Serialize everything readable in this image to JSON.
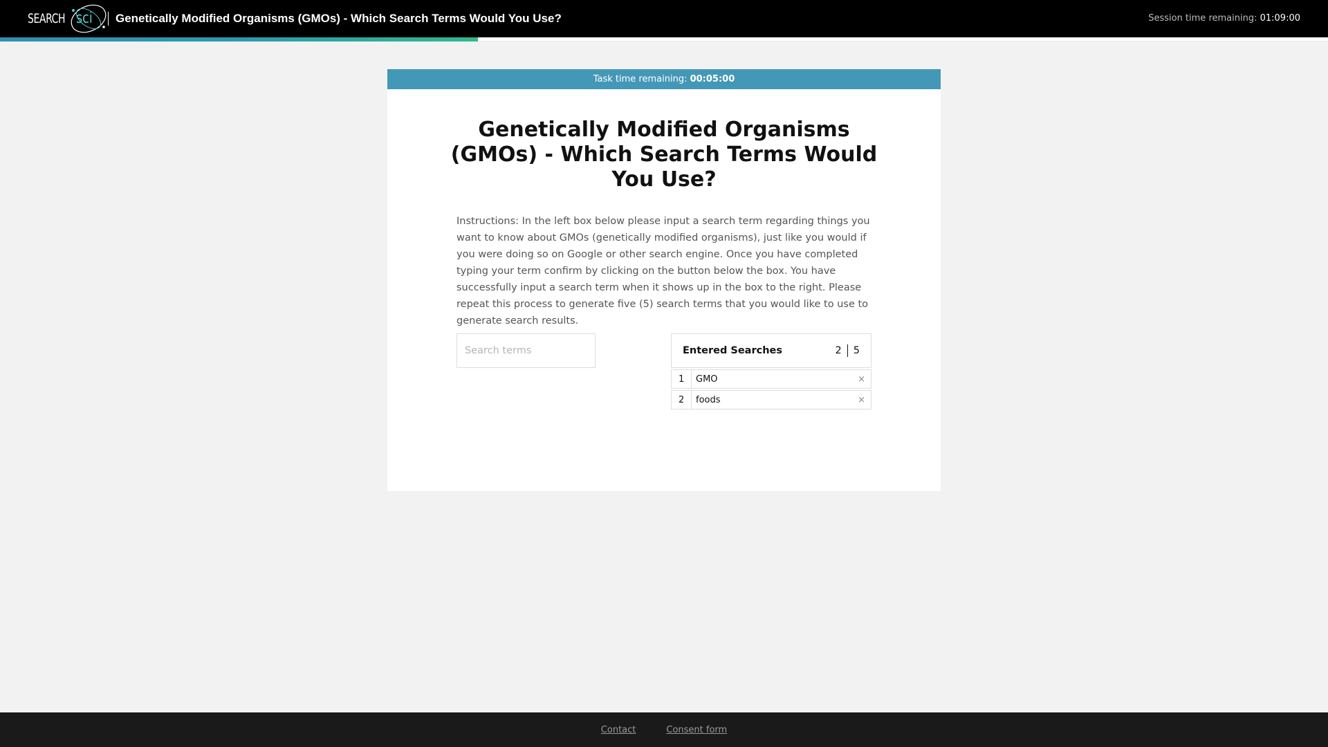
{
  "header": {
    "logo_search": "SEARCH",
    "logo_sci": "sci",
    "title": "Genetically Modified Organisms (GMOs) - Which Search Terms Would You Use?",
    "session_label": "Session time remaining:",
    "session_value": "01:09:00"
  },
  "progress": {
    "fraction": 0.36
  },
  "task": {
    "timer_label": "Task time remaining:",
    "timer_value": "00:05:00",
    "title": "Genetically Modified Organisms (GMOs) - Which Search Terms Would You Use?",
    "instructions": "Instructions: In the left box below please input a search term regarding things you want to know about GMOs (genetically modified organisms), just like you would if you were doing so on Google or other search engine. Once you have completed typing your term confirm by clicking on the button below the box. You have successfully input a search term when it shows up in the box to the right. Please repeat this process to generate five (5) search terms that you would like to use to generate search results."
  },
  "search": {
    "placeholder": "Search terms",
    "value": ""
  },
  "entered": {
    "label": "Entered Searches",
    "count": "2",
    "total": "5",
    "items": [
      {
        "num": "1",
        "term": "GMO",
        "remove": "×"
      },
      {
        "num": "2",
        "term": "foods",
        "remove": "×"
      }
    ]
  },
  "footer": {
    "contact": "Contact",
    "consent": "Consent form"
  },
  "colors": {
    "accent": "#4498b7",
    "logo_sci": "#58c7cf",
    "progress_start": "#2f8fb4",
    "progress_end": "#31b98c"
  }
}
